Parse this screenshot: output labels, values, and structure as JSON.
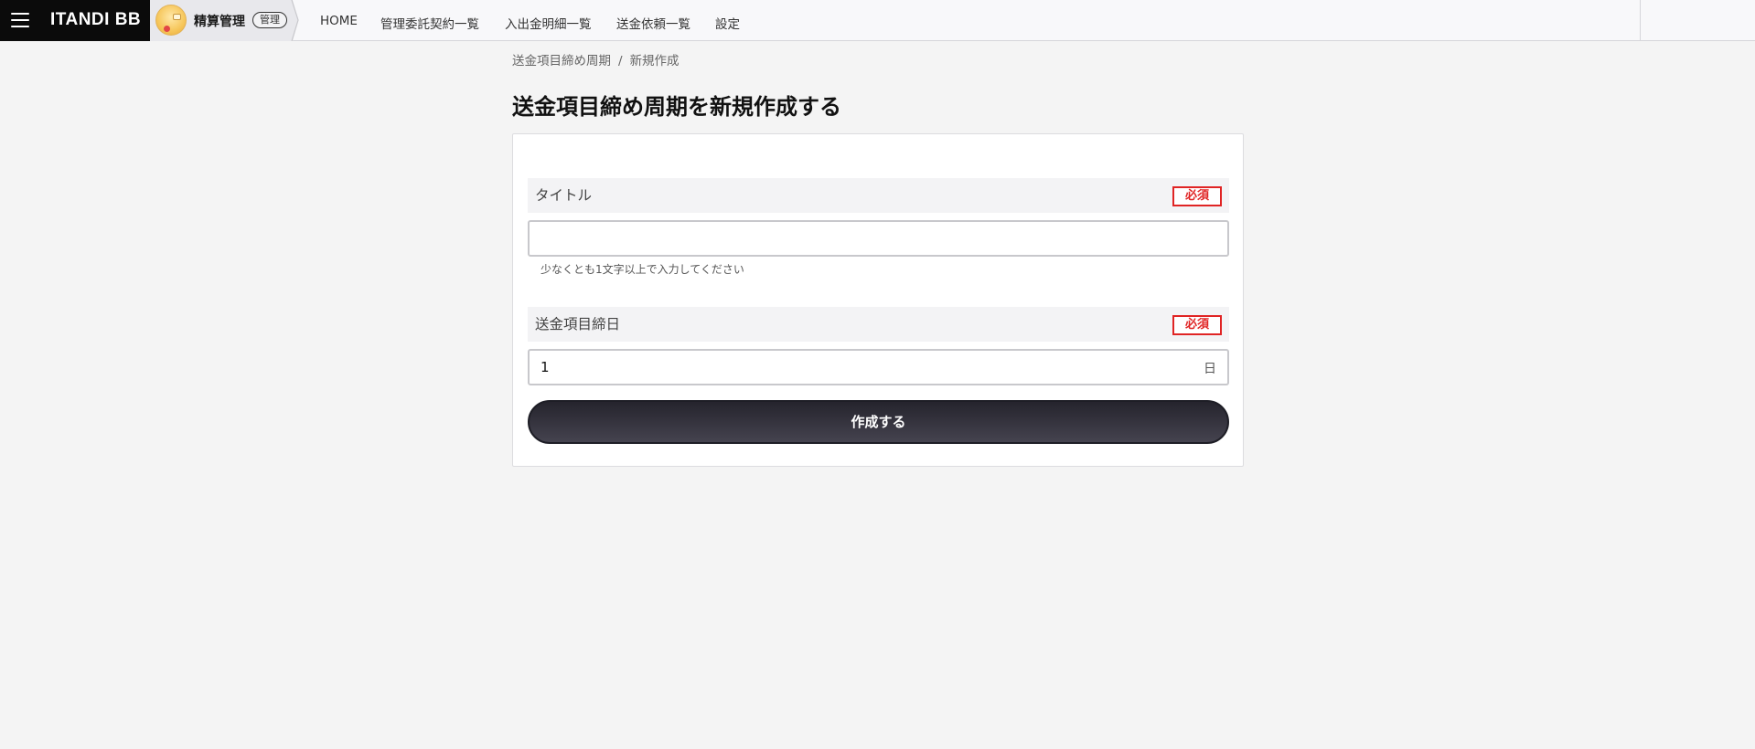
{
  "header": {
    "brand": "ITANDI BB",
    "app_name": "精算管理",
    "app_badge": "管理",
    "nav": [
      "HOME",
      "管理委託契約一覧",
      "入出金明細一覧",
      "送金依頼一覧",
      "設定"
    ]
  },
  "breadcrumb": {
    "parent": "送金項目締め周期",
    "separator": "/",
    "current": "新規作成"
  },
  "page": {
    "title": "送金項目締め周期を新規作成する"
  },
  "form": {
    "title_field": {
      "label": "タイトル",
      "required": "必須",
      "value": "",
      "hint": "少なくとも1文字以上で入力してください"
    },
    "closing_day_field": {
      "label": "送金項目締日",
      "required": "必須",
      "value": "1",
      "unit": "日"
    },
    "submit_label": "作成する"
  },
  "colors": {
    "accent_dark": "#2b2a33",
    "required_red": "#e02424",
    "header_black": "#0b0b0b"
  },
  "icons": [
    "menu-icon",
    "app-logo-icon"
  ]
}
